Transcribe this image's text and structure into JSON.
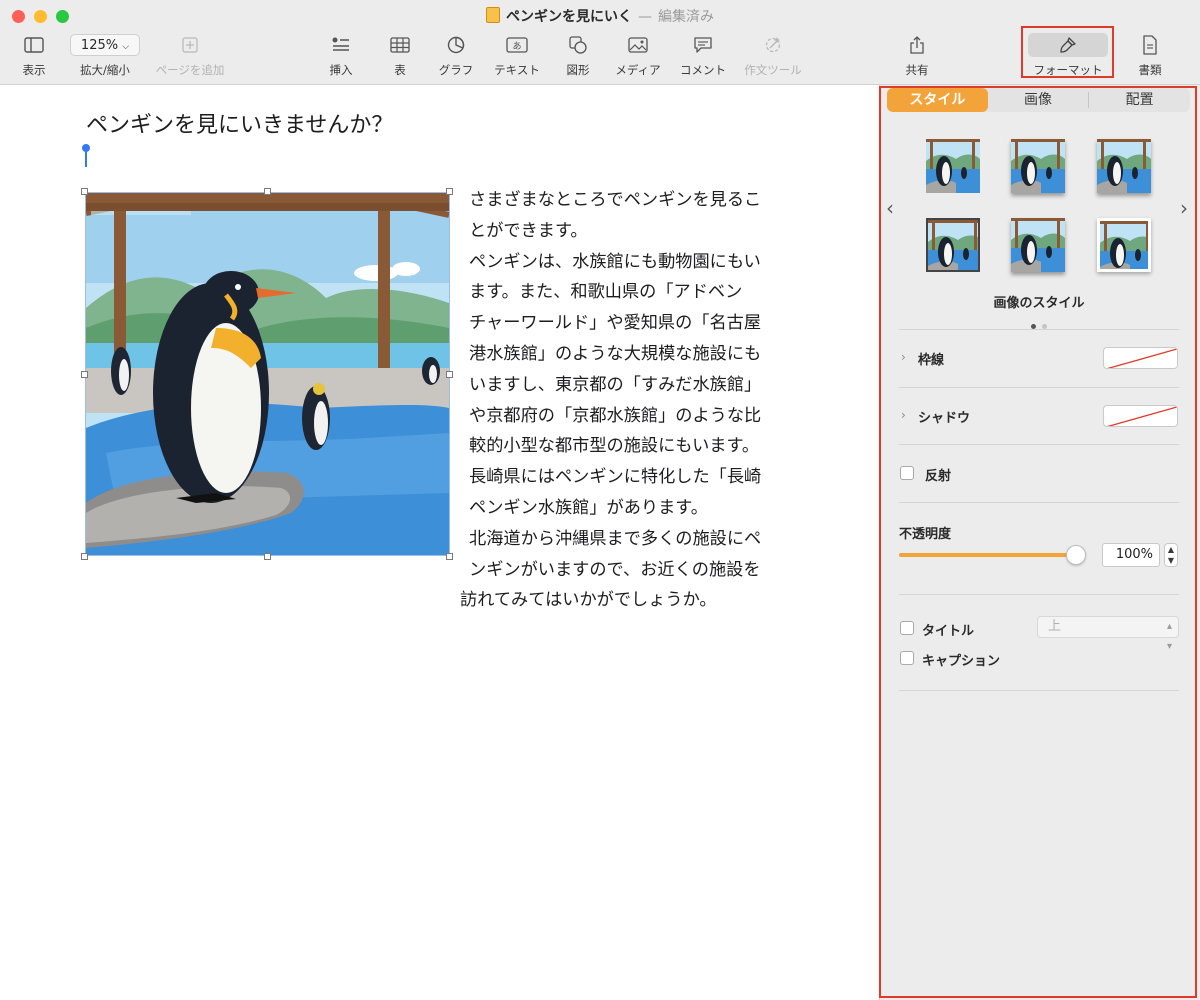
{
  "window": {
    "doc_name": "ペンギンを見にいく",
    "separator": "—",
    "status": "編集済み"
  },
  "toolbar": {
    "view": "表示",
    "zoom_value": "125%",
    "zoom": "拡大/縮小",
    "add_page": "ページを追加",
    "insert": "挿入",
    "table": "表",
    "chart": "グラフ",
    "text": "テキスト",
    "shape": "図形",
    "media": "メディア",
    "comment": "コメント",
    "writing_tools": "作文ツール",
    "share": "共有",
    "format": "フォーマット",
    "document": "書類"
  },
  "document": {
    "title": "ペンギンを見にいきませんか？",
    "lines": [
      "さまざまなところでペンギンを見るこ",
      "とができます。",
      "ペンギンは、水族館にも動物園にもい",
      "ます。また、和歌山県の「アドベン",
      "チャーワールド」や愛知県の「名古屋",
      "港水族館」のような大規模な施設にも",
      "いますし、東京都の「すみだ水族館」",
      "や京都府の「京都水族館」のような比",
      "較的小型な都市型の施設にもいます。",
      "長崎県にはペンギンに特化した「長崎",
      "ペンギン水族館」があります。",
      "北海道から沖縄県まで多くの施設にペ",
      "ンギンがいますので、お近くの施設を",
      "訪れてみてはいかがでしょうか。"
    ]
  },
  "inspector": {
    "tabs": [
      "スタイル",
      "画像",
      "配置"
    ],
    "active_tab": "スタイル",
    "styles_label": "画像のスタイル",
    "border_label": "枠線",
    "shadow_label": "シャドウ",
    "reflection_label": "反射",
    "opacity_label": "不透明度",
    "opacity_value": "100%",
    "opacity_level": 1.0,
    "title_label": "タイトル",
    "title_position": "上",
    "caption_label": "キャプション",
    "page_indicator": {
      "count": 2,
      "current": 1
    }
  },
  "colors": {
    "accent": "#f2a33a",
    "highlight": "#e03a2a",
    "selection": "#3478f6"
  }
}
